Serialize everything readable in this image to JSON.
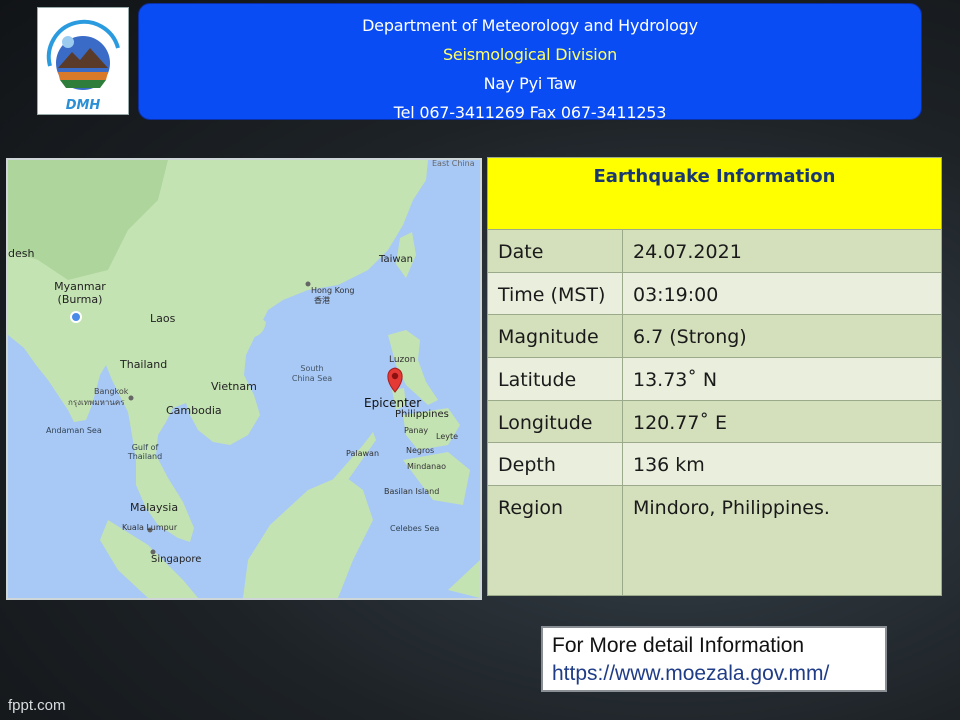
{
  "logo": {
    "text": "DMH"
  },
  "header": {
    "line1": "Department of Meteorology and Hydrology",
    "line2": "Seismological Division",
    "line3": "Nay Pyi Taw",
    "line4": "Tel 067-3411269 Fax 067-3411253"
  },
  "map": {
    "labels": {
      "east_china": "East China",
      "desh": "desh",
      "myanmar": "Myanmar",
      "burma": "(Burma)",
      "laos": "Laos",
      "thailand": "Thailand",
      "bangkok": "Bangkok",
      "bangkok_local": "กรุงเทพมหานคร",
      "vietnam": "Vietnam",
      "cambodia": "Cambodia",
      "andaman": "Andaman Sea",
      "gulf1": "Gulf of",
      "gulf2": "Thailand",
      "malaysia": "Malaysia",
      "kuala": "Kuala Lumpur",
      "singapore": "Singapore",
      "taiwan": "Taiwan",
      "hongkong": "Hong Kong",
      "hongkong_local": "香港",
      "scs1": "South",
      "scs2": "China Sea",
      "luzon": "Luzon",
      "epicenter": "Epicenter",
      "philippines": "Philippines",
      "panay": "Panay",
      "leyte": "Leyte",
      "palawan": "Palawan",
      "negros": "Negros",
      "mindanao": "Mindanao",
      "basilan": "Basilan Island",
      "celebes": "Celebes Sea"
    },
    "colors": {
      "sea": "#a8c8f5",
      "land": "#c4e3b3",
      "land_dark": "#aed59c",
      "pin": "#e53935"
    }
  },
  "info": {
    "title": "Earthquake Information",
    "rows": [
      {
        "label": "Date",
        "value": "24.07.2021"
      },
      {
        "label": "Time (MST)",
        "value": "03:19:00"
      },
      {
        "label": "Magnitude",
        "value": "6.7 (Strong)"
      },
      {
        "label": "Latitude",
        "value": "13.73˚ N"
      },
      {
        "label": "Longitude",
        "value": "120.77˚ E"
      },
      {
        "label": "Depth",
        "value": "136 km"
      },
      {
        "label": "Region",
        "value": "Mindoro, Philippines."
      }
    ],
    "colors": {
      "title_bg": "#ffff00",
      "row_dark": "#d4dfbc",
      "row_light": "#e9efdc"
    }
  },
  "more_info": {
    "line1": "For More detail Information",
    "line2": "https://www.moezala.gov.mm/"
  },
  "footer": {
    "text": "fppt.com"
  }
}
